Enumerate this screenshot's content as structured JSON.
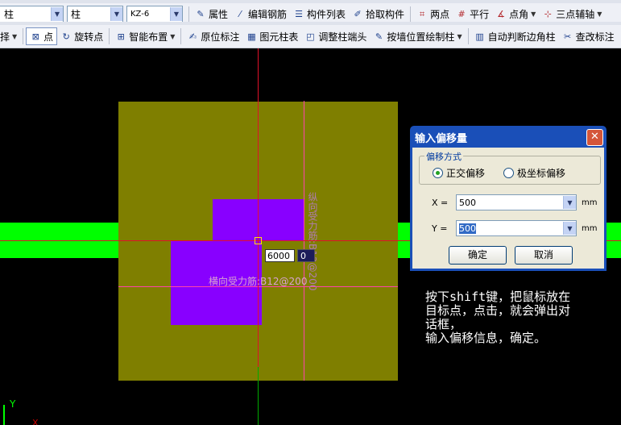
{
  "toolbar1": {
    "combos": [
      "柱",
      "柱",
      "KZ-6"
    ],
    "buttons": [
      {
        "label": "属性",
        "icon": "properties-icon"
      },
      {
        "label": "编辑钢筋",
        "icon": "edit-rebar-icon"
      },
      {
        "label": "构件列表",
        "icon": "component-list-icon"
      },
      {
        "label": "拾取构件",
        "icon": "pick-component-icon"
      },
      {
        "label": "两点",
        "icon": "two-point-axis-icon"
      },
      {
        "label": "平行",
        "icon": "parallel-axis-icon"
      },
      {
        "label": "点角",
        "icon": "point-angle-icon"
      },
      {
        "label": "三点辅轴",
        "icon": "three-point-axis-icon"
      }
    ]
  },
  "toolbar2": {
    "first": "择",
    "point": "点",
    "buttons": [
      {
        "label": "旋转点",
        "icon": "rotate-point-icon"
      },
      {
        "label": "智能布置",
        "icon": "smart-layout-icon"
      },
      {
        "label": "原位标注",
        "icon": "inplace-annotation-icon"
      },
      {
        "label": "图元柱表",
        "icon": "column-table-icon"
      },
      {
        "label": "调整柱端头",
        "icon": "adjust-column-end-icon"
      },
      {
        "label": "按墙位置绘制柱",
        "icon": "draw-column-by-wall-icon"
      },
      {
        "label": "自动判断边角柱",
        "icon": "auto-corner-column-icon"
      },
      {
        "label": "查改标注",
        "icon": "check-annotation-icon"
      }
    ]
  },
  "canvas": {
    "rebar_h": "横向受力筋:B12@200",
    "rebar_v": "纵向受力筋:B12@200",
    "dyn_input_1": "6000",
    "dyn_input_2": "0",
    "note": "按下shift键，把鼠标放在\n目标点，点击，就会弹出对\n话框，\n输入偏移信息，确定。",
    "ucs_label": "Y",
    "ucs_x_label": "X"
  },
  "dialog": {
    "title": "输入偏移量",
    "group_label": "偏移方式",
    "radio_orthogonal": "正交偏移",
    "radio_polar": "极坐标偏移",
    "x_label": "X =",
    "x_value": "500",
    "y_label": "Y =",
    "y_value": "500",
    "unit": "mm",
    "ok": "确定",
    "cancel": "取消"
  }
}
